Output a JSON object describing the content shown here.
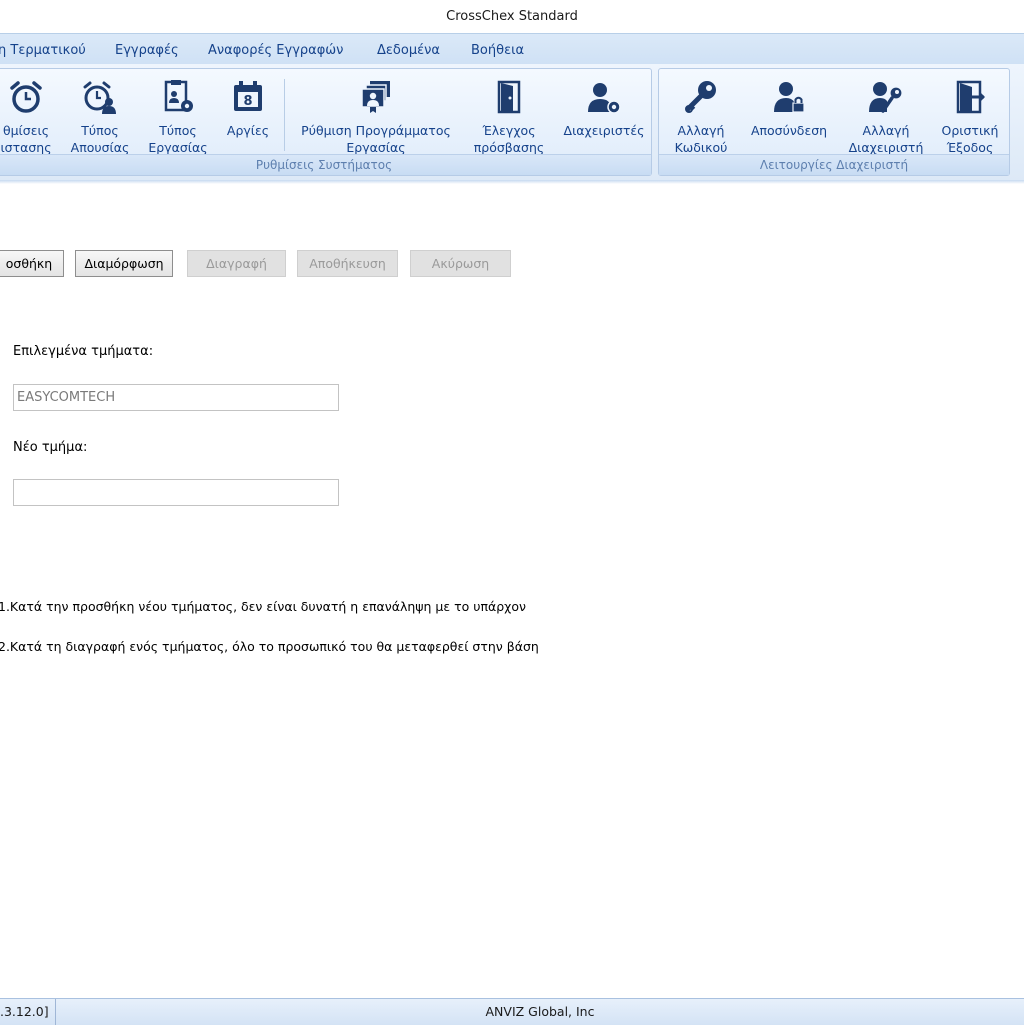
{
  "window": {
    "title": "CrossChex Standard"
  },
  "menu": [
    {
      "label": "η Τερματικού"
    },
    {
      "label": "Εγγραφές"
    },
    {
      "label": "Αναφορές Εγγραφών"
    },
    {
      "label": "Δεδομένα"
    },
    {
      "label": "Βοήθεια"
    }
  ],
  "ribbon": {
    "system_group": {
      "caption": "Ρυθμίσεις Συστήματος",
      "buttons": [
        {
          "label": "θμίσεις\nιστασης",
          "icon": "alarm-clock-icon"
        },
        {
          "label": "Τύπος\nΑπουσίας",
          "icon": "absence-clock-user-icon"
        },
        {
          "label": "Τύπος\nΕργασίας",
          "icon": "work-type-gear-icon"
        },
        {
          "label": "Αργίες",
          "icon": "calendar-icon",
          "day": "8"
        },
        {
          "label": "Ρύθμιση Προγράμματος\nΕργασίας",
          "icon": "schedule-icon"
        },
        {
          "label": "Έλεγχος\nπρόσβασης",
          "icon": "door-icon"
        },
        {
          "label": "Διαχειριστές",
          "icon": "admin-gear-icon"
        }
      ]
    },
    "admin_group": {
      "caption": "Λειτουργίες Διαχειριστή",
      "buttons": [
        {
          "label": "Αλλαγή\nΚωδικού",
          "icon": "key-icon"
        },
        {
          "label": "Αποσύνδεση",
          "icon": "user-lock-icon"
        },
        {
          "label": "Αλλαγή\nΔιαχειριστή",
          "icon": "user-key-icon"
        },
        {
          "label": "Οριστική\nΈξοδος",
          "icon": "exit-icon"
        }
      ]
    }
  },
  "toolbar": {
    "add": "οσθήκη",
    "modify": "Διαμόρφωση",
    "delete": "Διαγραφή",
    "save": "Αποθήκευση",
    "cancel": "Ακύρωση"
  },
  "form": {
    "selected_label": "Επιλεγμένα τμήματα:",
    "selected_value": "EASYCOMTECH",
    "new_label": "Νέο τμήμα:",
    "new_value": ""
  },
  "notes": [
    "1.Κατά την προσθήκη νέου τμήματος, δεν είναι δυνατή η επανάληψη με το υπάρχον",
    "2.Κατά τη διαγραφή ενός τμήματος, όλο το προσωπικό του θα μεταφερθεί στην βάση"
  ],
  "status": {
    "version": ".3.12.0]",
    "company": "ANVIZ Global, Inc"
  },
  "colors": {
    "icon": "#1f3d6e",
    "menu_text": "#15428b",
    "caption": "#5d7fae"
  }
}
